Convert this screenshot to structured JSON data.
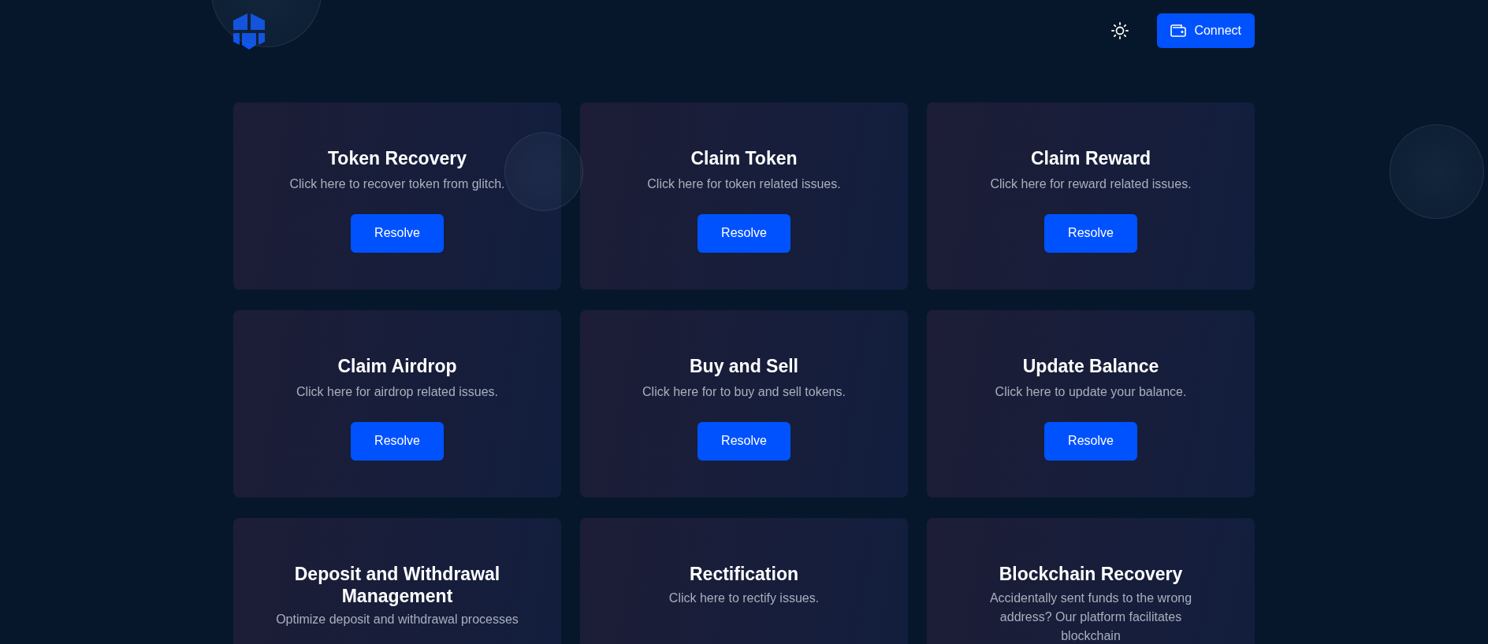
{
  "header": {
    "connect_button": "Connect"
  },
  "cards": [
    {
      "title": "Token Recovery",
      "description": "Click here to recover token from glitch.",
      "button": "Resolve"
    },
    {
      "title": "Claim Token",
      "description": "Click here for token related issues.",
      "button": "Resolve"
    },
    {
      "title": "Claim Reward",
      "description": "Click here for reward related issues.",
      "button": "Resolve"
    },
    {
      "title": "Claim Airdrop",
      "description": "Click here for airdrop related issues.",
      "button": "Resolve"
    },
    {
      "title": "Buy and Sell",
      "description": "Click here for to buy and sell tokens.",
      "button": "Resolve"
    },
    {
      "title": "Update Balance",
      "description": "Click here to update your balance.",
      "button": "Resolve"
    },
    {
      "title": "Deposit and Withdrawal Management",
      "description": "Optimize deposit and withdrawal processes"
    },
    {
      "title": "Rectification",
      "description": "Click here to rectify issues."
    },
    {
      "title": "Blockchain Recovery",
      "description": "Accidentally sent funds to the wrong address? Our platform facilitates blockchain"
    }
  ]
}
